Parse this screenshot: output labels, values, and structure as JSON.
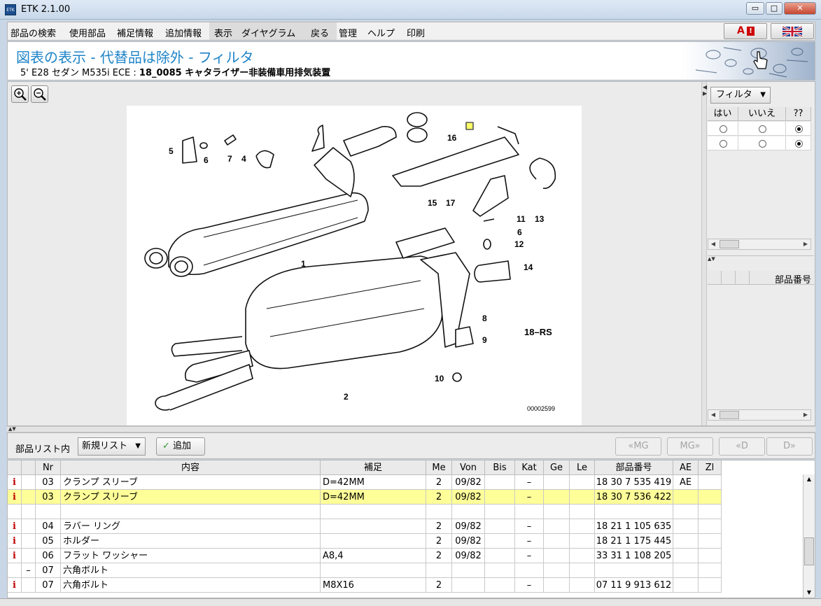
{
  "window": {
    "title": "ETK 2.1.00",
    "icon_text": "ETK",
    "minimize": "▭",
    "maximize": "□",
    "close": "✕"
  },
  "menu": [
    "部品の検索",
    "使用部品",
    "補足情報",
    "追加情報",
    "表示",
    "ダイヤグラム",
    "戻る",
    "管理",
    "ヘルプ",
    "印刷"
  ],
  "flag_buttons": {
    "left_label": "A",
    "left_badge": "!",
    "right_label": "UK"
  },
  "header": {
    "title": "図表の表示 - 代替品は除外 - フィルタ",
    "subtitle_prefix": "5' E28 セダン M535i ECE : ",
    "subtitle_bold": "18_0085 キャタライザー非装備車用排気装置"
  },
  "diagram": {
    "callouts": [
      "1",
      "2",
      "4",
      "5",
      "6",
      "7",
      "16",
      "15",
      "17",
      "11",
      "13",
      "6",
      "12",
      "14",
      "8",
      "9",
      "10"
    ],
    "model_code": "18–RS",
    "image_number": "00002599"
  },
  "filter": {
    "dropdown_label": "フィルタ",
    "columns": [
      "はい",
      "いいえ",
      "??"
    ],
    "rows": [
      {
        "selected": "??"
      },
      {
        "selected": "??"
      }
    ],
    "parts_header": "部品番号"
  },
  "list_toolbar": {
    "label": "部品リスト内",
    "select_value": "新規リスト",
    "add_label": "追加",
    "nav_buttons": [
      "«MG",
      "MG»",
      "«D",
      "D»"
    ]
  },
  "table": {
    "columns": [
      "",
      "",
      "Nr",
      "内容",
      "補足",
      "Me",
      "Von",
      "Bis",
      "Kat",
      "Ge",
      "Le",
      "部品番号",
      "AE",
      "Zl"
    ],
    "rows": [
      {
        "info": "i",
        "mark": "",
        "nr": "03",
        "desc": "クランプ スリーブ",
        "note": "D=42MM",
        "me": "2",
        "von": "09/82",
        "bis": "",
        "kat": "–",
        "ge": "",
        "le": "",
        "part": "18 30 7 535 419",
        "ae": "AE",
        "zl": ""
      },
      {
        "info": "i",
        "mark": "",
        "nr": "03",
        "desc": "クランプ スリーブ",
        "note": "D=42MM",
        "me": "2",
        "von": "09/82",
        "bis": "",
        "kat": "–",
        "ge": "",
        "le": "",
        "part": "18 30 7 536 422",
        "ae": "",
        "zl": "",
        "highlight": true
      },
      {
        "info": "",
        "mark": "",
        "nr": "",
        "desc": "",
        "note": "",
        "me": "",
        "von": "",
        "bis": "",
        "kat": "",
        "ge": "",
        "le": "",
        "part": "",
        "ae": "",
        "zl": ""
      },
      {
        "info": "i",
        "mark": "",
        "nr": "04",
        "desc": "ラバー リング",
        "note": "",
        "me": "2",
        "von": "09/82",
        "bis": "",
        "kat": "–",
        "ge": "",
        "le": "",
        "part": "18 21 1 105 635",
        "ae": "",
        "zl": ""
      },
      {
        "info": "i",
        "mark": "",
        "nr": "05",
        "desc": "ホルダー",
        "note": "",
        "me": "2",
        "von": "09/82",
        "bis": "",
        "kat": "–",
        "ge": "",
        "le": "",
        "part": "18 21 1 175 445",
        "ae": "",
        "zl": ""
      },
      {
        "info": "i",
        "mark": "",
        "nr": "06",
        "desc": "フラット ワッシャー",
        "note": "A8,4",
        "me": "2",
        "von": "09/82",
        "bis": "",
        "kat": "–",
        "ge": "",
        "le": "",
        "part": "33 31 1 108 205",
        "ae": "",
        "zl": ""
      },
      {
        "info": "",
        "mark": "–",
        "nr": "07",
        "desc": "六角ボルト",
        "note": "",
        "me": "",
        "von": "",
        "bis": "",
        "kat": "",
        "ge": "",
        "le": "",
        "part": "",
        "ae": "",
        "zl": ""
      },
      {
        "info": "i",
        "mark": "",
        "nr": "07",
        "desc": "六角ボルト",
        "note": "M8X16",
        "me": "2",
        "von": "",
        "bis": "",
        "kat": "–",
        "ge": "",
        "le": "",
        "part": "07 11 9 913 612",
        "ae": "",
        "zl": ""
      }
    ]
  }
}
